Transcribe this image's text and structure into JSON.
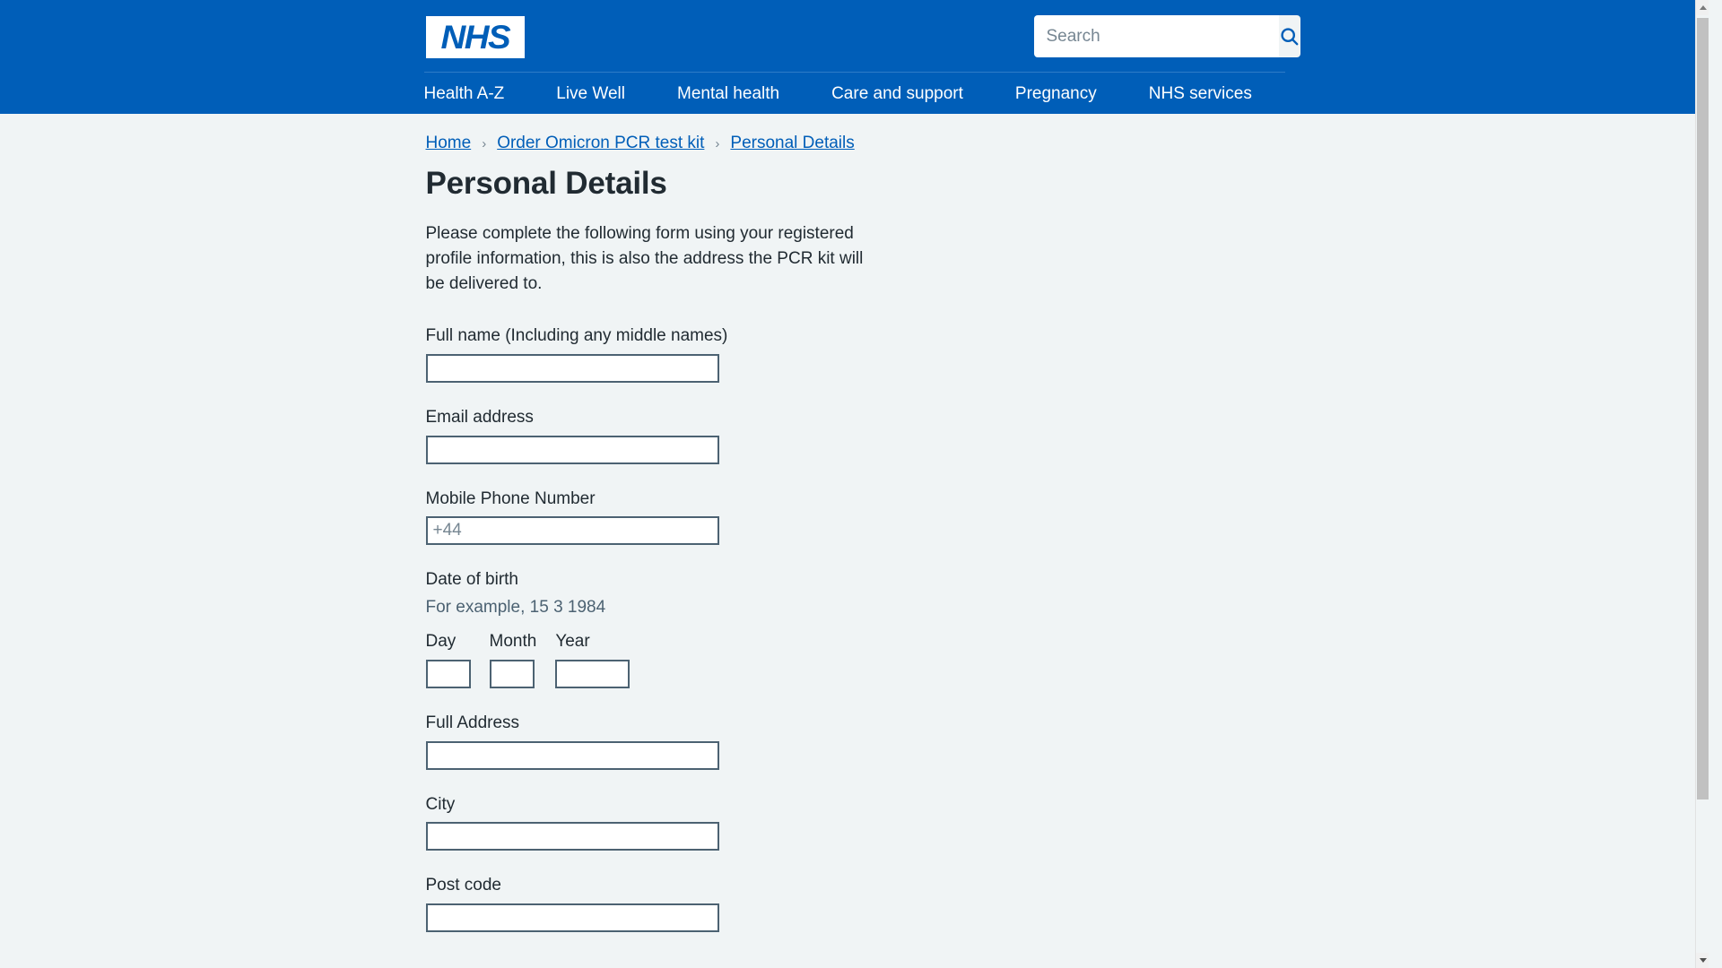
{
  "header": {
    "logo_text": "NHS",
    "logo_name": "nhs-logo",
    "search": {
      "placeholder": "Search",
      "value": "",
      "button_icon": "search-icon"
    },
    "nav_items": [
      {
        "label": "Health A-Z"
      },
      {
        "label": "Live Well"
      },
      {
        "label": "Mental health"
      },
      {
        "label": "Care and support"
      },
      {
        "label": "Pregnancy"
      },
      {
        "label": "NHS services"
      }
    ]
  },
  "breadcrumb": {
    "separator": "›",
    "items": [
      {
        "label": "Home"
      },
      {
        "label": "Order Omicron PCR test kit"
      },
      {
        "label": "Personal Details"
      }
    ]
  },
  "main": {
    "title": "Personal Details",
    "intro": "Please complete the following form using your registered profile information, this is also the address the PCR kit will be delivered to.",
    "fields": {
      "full_name": {
        "label": "Full name (Including any middle names)",
        "value": "",
        "placeholder": ""
      },
      "email": {
        "label": "Email address",
        "value": "",
        "placeholder": ""
      },
      "mobile": {
        "label": "Mobile Phone Number",
        "value": "",
        "placeholder": "+44"
      },
      "dob": {
        "label": "Date of birth",
        "hint": "For example, 15 3 1984",
        "day": {
          "label": "Day",
          "value": ""
        },
        "month": {
          "label": "Month",
          "value": ""
        },
        "year": {
          "label": "Year",
          "value": ""
        }
      },
      "address": {
        "label": "Full Address",
        "value": "",
        "placeholder": ""
      },
      "city": {
        "label": "City",
        "value": "",
        "placeholder": ""
      },
      "postcode": {
        "label": "Post code",
        "value": "",
        "placeholder": ""
      }
    }
  },
  "colors": {
    "nhs_blue": "#005eb8",
    "page_background": "#f0f4f5",
    "text": "#212b32",
    "input_border": "#4c6272",
    "hint_text": "#4c6272",
    "link": "#005eb8"
  }
}
